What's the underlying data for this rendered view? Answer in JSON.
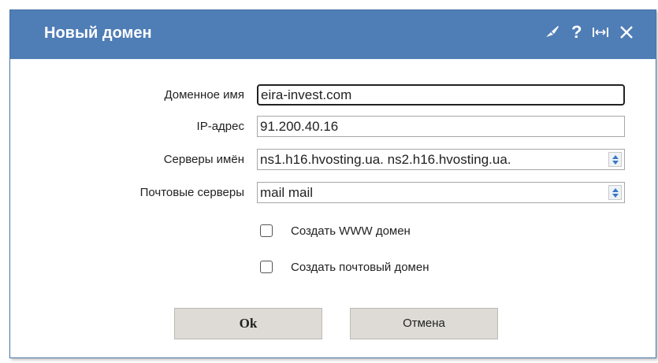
{
  "dialog": {
    "title": "Новый домен",
    "icons": {
      "brush": "brush-icon",
      "help": "help-icon",
      "resize": "resize-icon",
      "close": "close-icon"
    },
    "help_glyph": "?"
  },
  "form": {
    "domain": {
      "label": "Доменное имя",
      "value": "eira-invest.com"
    },
    "ip": {
      "label": "IP-адрес",
      "value": "91.200.40.16"
    },
    "ns": {
      "label": "Серверы имён",
      "value": "ns1.h16.hvosting.ua. ns2.h16.hvosting.ua."
    },
    "mail": {
      "label": "Почтовые серверы",
      "value": "mail mail"
    },
    "create_www": {
      "label": "Создать WWW домен",
      "checked": false
    },
    "create_mail": {
      "label": "Создать почтовый домен",
      "checked": false
    }
  },
  "buttons": {
    "ok": "Ok",
    "cancel": "Отмена"
  },
  "colors": {
    "titlebar": "#4f7db6",
    "button": "#dedbd6"
  }
}
